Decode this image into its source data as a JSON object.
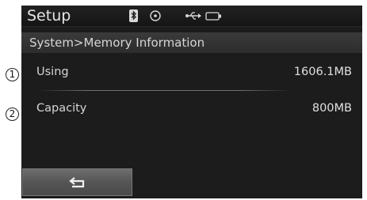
{
  "header": {
    "title": "Setup",
    "icons": [
      "bluetooth-icon",
      "disc-icon",
      "usb-icon",
      "battery-icon"
    ]
  },
  "subtitle": "System>Memory Information",
  "rows": [
    {
      "callout": "1",
      "label": "Using",
      "value": "1606.1MB"
    },
    {
      "callout": "2",
      "label": "Capacity",
      "value": "800MB"
    }
  ],
  "footer": {
    "back_icon": "back-arrow-icon"
  },
  "colors": {
    "screen_bg": "#1c1c1c",
    "text": "#d6d6d6",
    "button": "#5a5a5a"
  }
}
